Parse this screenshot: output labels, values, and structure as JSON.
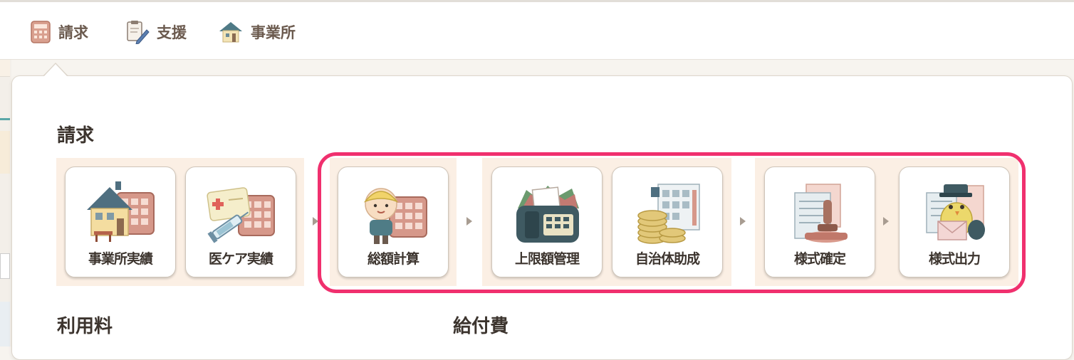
{
  "nav": {
    "items": [
      {
        "label": "請求",
        "icon": "calculator-icon"
      },
      {
        "label": "支援",
        "icon": "clipboard-pen-icon"
      },
      {
        "label": "事業所",
        "icon": "house-icon"
      }
    ]
  },
  "menu": {
    "billing_title": "請求",
    "usage_title": "利用料",
    "benefit_title": "給付費",
    "cards": [
      {
        "label": "事業所実績",
        "icon": "house-calendar-icon"
      },
      {
        "label": "医ケア実績",
        "icon": "medical-card-syringe-icon"
      },
      {
        "label": "総額計算",
        "icon": "child-calculator-icon"
      },
      {
        "label": "上限額管理",
        "icon": "fax-machine-icon"
      },
      {
        "label": "自治体助成",
        "icon": "coins-building-icon"
      },
      {
        "label": "様式確定",
        "icon": "stamp-document-icon"
      },
      {
        "label": "様式出力",
        "icon": "mail-bird-icon"
      }
    ]
  },
  "colors": {
    "highlight": "#f0306e",
    "group_bg": "#fbefe4",
    "text": "#3c342e",
    "nav_text": "#6b5a4e"
  }
}
